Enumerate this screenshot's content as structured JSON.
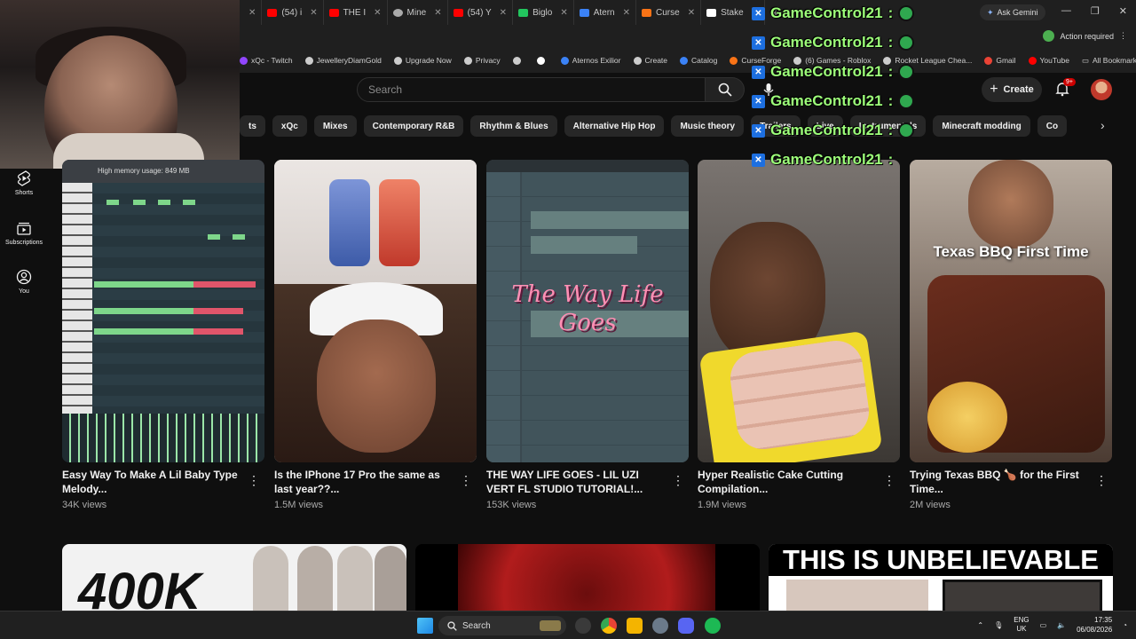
{
  "browser": {
    "tabs": [
      {
        "label": "",
        "color": "#ff0000"
      },
      {
        "label": "(54) i",
        "color": "#ff0000"
      },
      {
        "label": "THE I",
        "color": "#ff0000"
      },
      {
        "label": "Mine",
        "color": "#aaaaaa"
      },
      {
        "label": "(54) Y",
        "color": "#ff0000"
      },
      {
        "label": "Biglo",
        "color": "#22c55e"
      },
      {
        "label": "Atern",
        "color": "#3b82f6"
      },
      {
        "label": "Curse",
        "color": "#f97316"
      },
      {
        "label": "Stake",
        "color": "#ffffff"
      }
    ],
    "new_tab": "+",
    "gemini_label": "Ask Gemini",
    "action_required": "Action required",
    "bookmarks": [
      {
        "label": "xQc - Twitch",
        "color": "#9146ff"
      },
      {
        "label": "JewelleryDiamGold",
        "color": "#cccccc"
      },
      {
        "label": "Upgrade Now",
        "color": "#cccccc"
      },
      {
        "label": "Privacy",
        "color": "#cccccc"
      },
      {
        "label": "",
        "color": "#cccccc"
      },
      {
        "label": "",
        "color": "#ffffff"
      },
      {
        "label": "Aternos Exilior",
        "color": "#3b82f6"
      },
      {
        "label": "Create",
        "color": "#cccccc"
      },
      {
        "label": "Catalog",
        "color": "#3b82f6"
      },
      {
        "label": "CurseForge",
        "color": "#f97316"
      },
      {
        "label": "(6) Games - Roblox",
        "color": "#cccccc"
      },
      {
        "label": "Rocket League Chea...",
        "color": "#cccccc"
      },
      {
        "label": "Gmail",
        "color": "#ea4335"
      },
      {
        "label": "YouTube",
        "color": "#ff0000"
      }
    ],
    "all_bookmarks": "All Bookmarks"
  },
  "youtube": {
    "search_placeholder": "Search",
    "create_label": "Create",
    "notif_badge": "9+",
    "chips": [
      "ts",
      "xQc",
      "Mixes",
      "Contemporary R&B",
      "Rhythm & Blues",
      "Alternative Hip Hop",
      "Music theory",
      "Trailers",
      "Live",
      "Instrumentals",
      "Minecraft modding",
      "Co"
    ],
    "sidebar": [
      {
        "label": "Shorts"
      },
      {
        "label": "Subscriptions"
      },
      {
        "label": "You"
      }
    ],
    "videos": [
      {
        "title": "Easy Way To Make A Lil Baby Type Melody...",
        "views": "34K views"
      },
      {
        "title": "Is the IPhone 17 Pro the same as last year??...",
        "views": "1.5M views"
      },
      {
        "title": "THE WAY LIFE GOES - LIL UZI VERT FL STUDIO TUTORIAL!...",
        "views": "153K views"
      },
      {
        "title": "Hyper Realistic Cake Cutting Compilation...",
        "views": "1.9M views"
      },
      {
        "title": "Trying Texas BBQ 🍗 for the First Time...",
        "views": "2M views"
      }
    ],
    "thumb_text": {
      "memory": "High memory usage: 849 MB",
      "way_life": "The Way Life Goes",
      "texas": "Texas BBQ First Time",
      "unbelievable": "THIS IS UNBELIEVABLE",
      "k400": "400K"
    }
  },
  "overlay": {
    "chat_lines": [
      {
        "user": "GameControl21",
        "sep": ":"
      },
      {
        "user": "GameControl21",
        "sep": ":"
      },
      {
        "user": "GameControl21",
        "sep": ":"
      },
      {
        "user": "GameControl21",
        "sep": ":"
      },
      {
        "user": "GameControl21",
        "sep": ":"
      },
      {
        "user": "GameControl21",
        "sep": ":"
      }
    ],
    "color": "#9dff7a"
  },
  "taskbar": {
    "search_label": "Search",
    "lang_top": "ENG",
    "lang_bottom": "UK",
    "time": "17:35",
    "date": "06/08/2026"
  }
}
